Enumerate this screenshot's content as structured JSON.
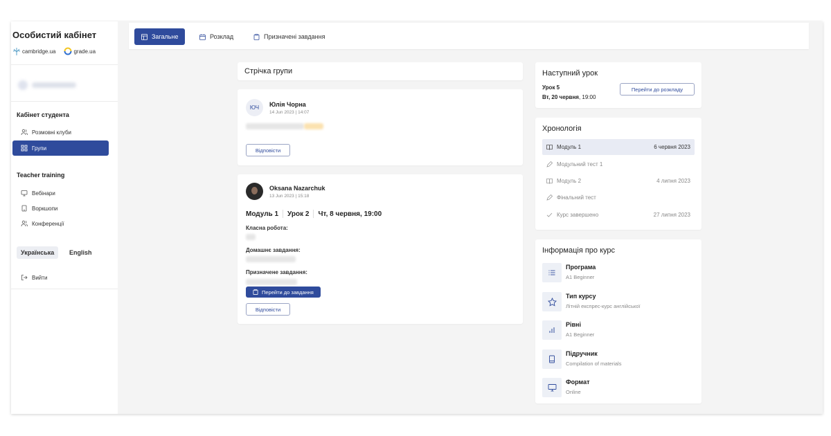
{
  "sidebar": {
    "title": "Особистий кабінет",
    "logos": [
      "cambridge.ua",
      "grade.ua"
    ],
    "student_section": "Кабінет студента",
    "student_items": [
      {
        "label": "Розмовні клуби",
        "icon": "users-icon"
      },
      {
        "label": "Групи",
        "icon": "grid-icon",
        "active": true
      }
    ],
    "teacher_section": "Teacher training",
    "teacher_items": [
      {
        "label": "Вебінари",
        "icon": "monitor-icon"
      },
      {
        "label": "Воркшопи",
        "icon": "tablet-icon"
      },
      {
        "label": "Конференції",
        "icon": "users-icon"
      }
    ],
    "languages": [
      "Українська",
      "English"
    ],
    "logout": "Вийти"
  },
  "tabs": [
    {
      "label": "Загальне",
      "icon": "layout-icon",
      "active": true
    },
    {
      "label": "Розклад",
      "icon": "calendar-icon"
    },
    {
      "label": "Призначені завдання",
      "icon": "clipboard-icon"
    }
  ],
  "feed": {
    "title": "Стрічка групи",
    "posts": [
      {
        "initials": "ЮЧ",
        "author": "Юлія Чорна",
        "date": "14 Jun 2023 | 14:07",
        "reply": "Відповісти"
      },
      {
        "author": "Oksana Nazarchuk",
        "date": "13 Jun 2023 | 15:18",
        "module": "Модуль 1",
        "lesson": "Урок 2",
        "when": "Чт, 8 червня, 19:00",
        "classwork": "Класна робота:",
        "homework": "Домашнє завдання:",
        "assigned": "Призначене завдання:",
        "go_to_task": "Перейти до завдання",
        "reply": "Відповісти"
      }
    ]
  },
  "next_lesson": {
    "title": "Наступний урок",
    "lesson": "Урок 5",
    "day": "Вт, 20 червня",
    "time": ", 19:00",
    "button": "Перейти до розкладу"
  },
  "timeline": {
    "title": "Хронологія",
    "items": [
      {
        "label": "Модуль 1",
        "date": "6 червня 2023",
        "icon": "book-icon",
        "active": true
      },
      {
        "label": "Модульний тест 1",
        "date": "",
        "icon": "pencil-icon"
      },
      {
        "label": "Модуль 2",
        "date": "4 липня 2023",
        "icon": "book-icon"
      },
      {
        "label": "Фінальний тест",
        "date": "",
        "icon": "pencil-icon"
      },
      {
        "label": "Курс завершено",
        "date": "27 липня 2023",
        "icon": "check-icon"
      }
    ]
  },
  "course_info": {
    "title": "Інформація про курс",
    "items": [
      {
        "title": "Програма",
        "sub": "A1 Beginner",
        "icon": "list-icon"
      },
      {
        "title": "Тип курсу",
        "sub": "Літній експрес-курс англійської",
        "icon": "star-icon"
      },
      {
        "title": "Рівні",
        "sub": "A1 Beginner",
        "icon": "bar-chart-icon"
      },
      {
        "title": "Підручник",
        "sub": "Compilation of materials",
        "icon": "book-icon"
      },
      {
        "title": "Формат",
        "sub": "Online",
        "icon": "monitor-icon"
      }
    ]
  },
  "colors": {
    "accent": "#2f4b9c",
    "background": "#f4f4f4"
  }
}
